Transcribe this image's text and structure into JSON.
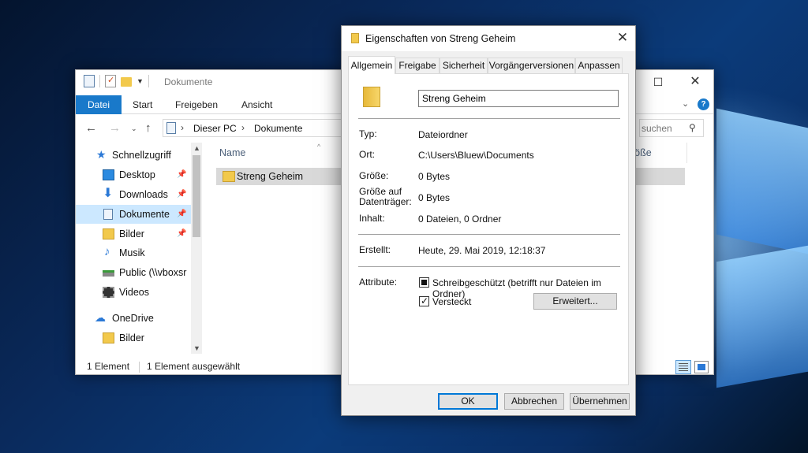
{
  "explorer": {
    "title": "Dokumente",
    "ribbon_tabs": [
      "Datei",
      "Start",
      "Freigeben",
      "Ansicht"
    ],
    "address": [
      "Dieser PC",
      "Dokumente"
    ],
    "search_placeholder": "suchen",
    "nav_items": [
      {
        "label": "Schnellzugriff",
        "icon": "star-icon",
        "pinned": false
      },
      {
        "label": "Desktop",
        "icon": "desktop-icon",
        "pinned": true
      },
      {
        "label": "Downloads",
        "icon": "download-icon",
        "pinned": true
      },
      {
        "label": "Dokumente",
        "icon": "document-icon",
        "pinned": true,
        "selected": true
      },
      {
        "label": "Bilder",
        "icon": "pictures-icon",
        "pinned": true
      },
      {
        "label": "Musik",
        "icon": "music-icon",
        "pinned": false
      },
      {
        "label": "Public (\\\\vboxsr",
        "icon": "network-drive-icon",
        "pinned": false
      },
      {
        "label": "Videos",
        "icon": "video-icon",
        "pinned": false
      },
      {
        "label": "OneDrive",
        "icon": "cloud-icon",
        "pinned": false
      },
      {
        "label": "Bilder",
        "icon": "folder-icon",
        "pinned": false
      }
    ],
    "columns": {
      "name": "Name",
      "size": "röße"
    },
    "files": [
      {
        "name": "Streng Geheim",
        "icon": "folder-icon",
        "selected": true
      }
    ],
    "status": {
      "count": "1 Element",
      "selection": "1 Element ausgewählt"
    }
  },
  "dialog": {
    "title": "Eigenschaften von Streng Geheim",
    "tabs": [
      "Allgemein",
      "Freigabe",
      "Sicherheit",
      "Vorgängerversionen",
      "Anpassen"
    ],
    "active_tab": "Allgemein",
    "name_value": "Streng Geheim",
    "props": {
      "typ_label": "Typ:",
      "typ": "Dateiordner",
      "ort_label": "Ort:",
      "ort": "C:\\Users\\Bluew\\Documents",
      "groesse_label": "Größe:",
      "groesse": "0 Bytes",
      "datentraeger_label": "Größe auf Datenträger:",
      "datentraeger": "0 Bytes",
      "inhalt_label": "Inhalt:",
      "inhalt": "0 Dateien, 0 Ordner",
      "erstellt_label": "Erstellt:",
      "erstellt": "Heute, 29. Mai 2019, 12:18:37",
      "attribute_label": "Attribute:"
    },
    "attributes": {
      "readonly_label": "Schreibgeschützt (betrifft nur Dateien im Ordner)",
      "readonly_state": "indeterminate",
      "hidden_label": "Versteckt",
      "hidden_state": "checked",
      "advanced_button": "Erweitert..."
    },
    "buttons": {
      "ok": "OK",
      "cancel": "Abbrechen",
      "apply": "Übernehmen"
    }
  },
  "colors": {
    "accent": "#1979ca",
    "selection": "#cce8ff",
    "folder": "#f2c94c"
  }
}
